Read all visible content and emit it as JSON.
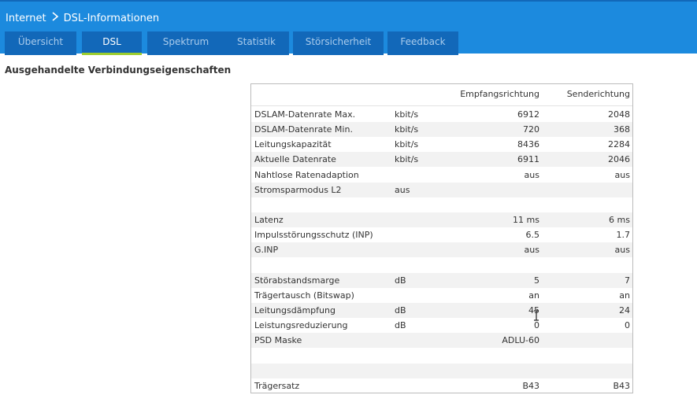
{
  "breadcrumb": {
    "parent": "Internet",
    "current": "DSL-Informationen"
  },
  "tabs": [
    {
      "label": "Übersicht",
      "active": false
    },
    {
      "label": "DSL",
      "active": true
    },
    {
      "label": "Spektrum",
      "active": false
    },
    {
      "label": "Statistik",
      "active": false
    },
    {
      "label": "Störsicherheit",
      "active": false
    },
    {
      "label": "Feedback",
      "active": false
    }
  ],
  "section_title": "Ausgehandelte Verbindungseigenschaften",
  "table": {
    "headers": {
      "rx": "Empfangsrichtung",
      "tx": "Senderichtung"
    },
    "rows": [
      {
        "label": "DSLAM-Datenrate Max.",
        "unit": "kbit/s",
        "rx": "6912",
        "tx": "2048"
      },
      {
        "label": "DSLAM-Datenrate Min.",
        "unit": "kbit/s",
        "rx": "720",
        "tx": "368"
      },
      {
        "label": "Leitungskapazität",
        "unit": "kbit/s",
        "rx": "8436",
        "tx": "2284"
      },
      {
        "label": "Aktuelle Datenrate",
        "unit": "kbit/s",
        "rx": "6911",
        "tx": "2046"
      },
      {
        "label": "Nahtlose Ratenadaption",
        "unit": "",
        "rx": "aus",
        "tx": "aus"
      },
      {
        "label": "Stromsparmodus L2",
        "unit": "aus",
        "rx": "",
        "tx": ""
      },
      {
        "label": "",
        "unit": "",
        "rx": "",
        "tx": ""
      },
      {
        "label": "Latenz",
        "unit": "",
        "rx": "11 ms",
        "tx": "6 ms"
      },
      {
        "label": "Impulsstörungsschutz (INP)",
        "unit": "",
        "rx": "6.5",
        "tx": "1.7"
      },
      {
        "label": "G.INP",
        "unit": "",
        "rx": "aus",
        "tx": "aus"
      },
      {
        "label": "",
        "unit": "",
        "rx": "",
        "tx": ""
      },
      {
        "label": "Störabstandsmarge",
        "unit": "dB",
        "rx": "5",
        "tx": "7"
      },
      {
        "label": "Trägertausch (Bitswap)",
        "unit": "",
        "rx": "an",
        "tx": "an"
      },
      {
        "label": "Leitungsdämpfung",
        "unit": "dB",
        "rx": "45",
        "tx": "24"
      },
      {
        "label": "Leistungsreduzierung",
        "unit": "dB",
        "rx": "0",
        "tx": "0"
      },
      {
        "label": "PSD Maske",
        "unit": "",
        "rx": "ADLU-60",
        "tx": ""
      },
      {
        "label": "",
        "unit": "",
        "rx": "",
        "tx": ""
      },
      {
        "label": "",
        "unit": "",
        "rx": "",
        "tx": ""
      },
      {
        "label": "Trägersatz",
        "unit": "",
        "rx": "B43",
        "tx": "B43"
      }
    ]
  },
  "colors": {
    "header_bg": "#1c8ade",
    "tab_bg": "#1268b9",
    "tab_active_underline": "#9ccd2e",
    "row_alt": "#f2f2f2"
  },
  "icons": {
    "breadcrumb_separator": "chevron-right-icon",
    "mouse_cursor": "text-cursor-icon"
  }
}
